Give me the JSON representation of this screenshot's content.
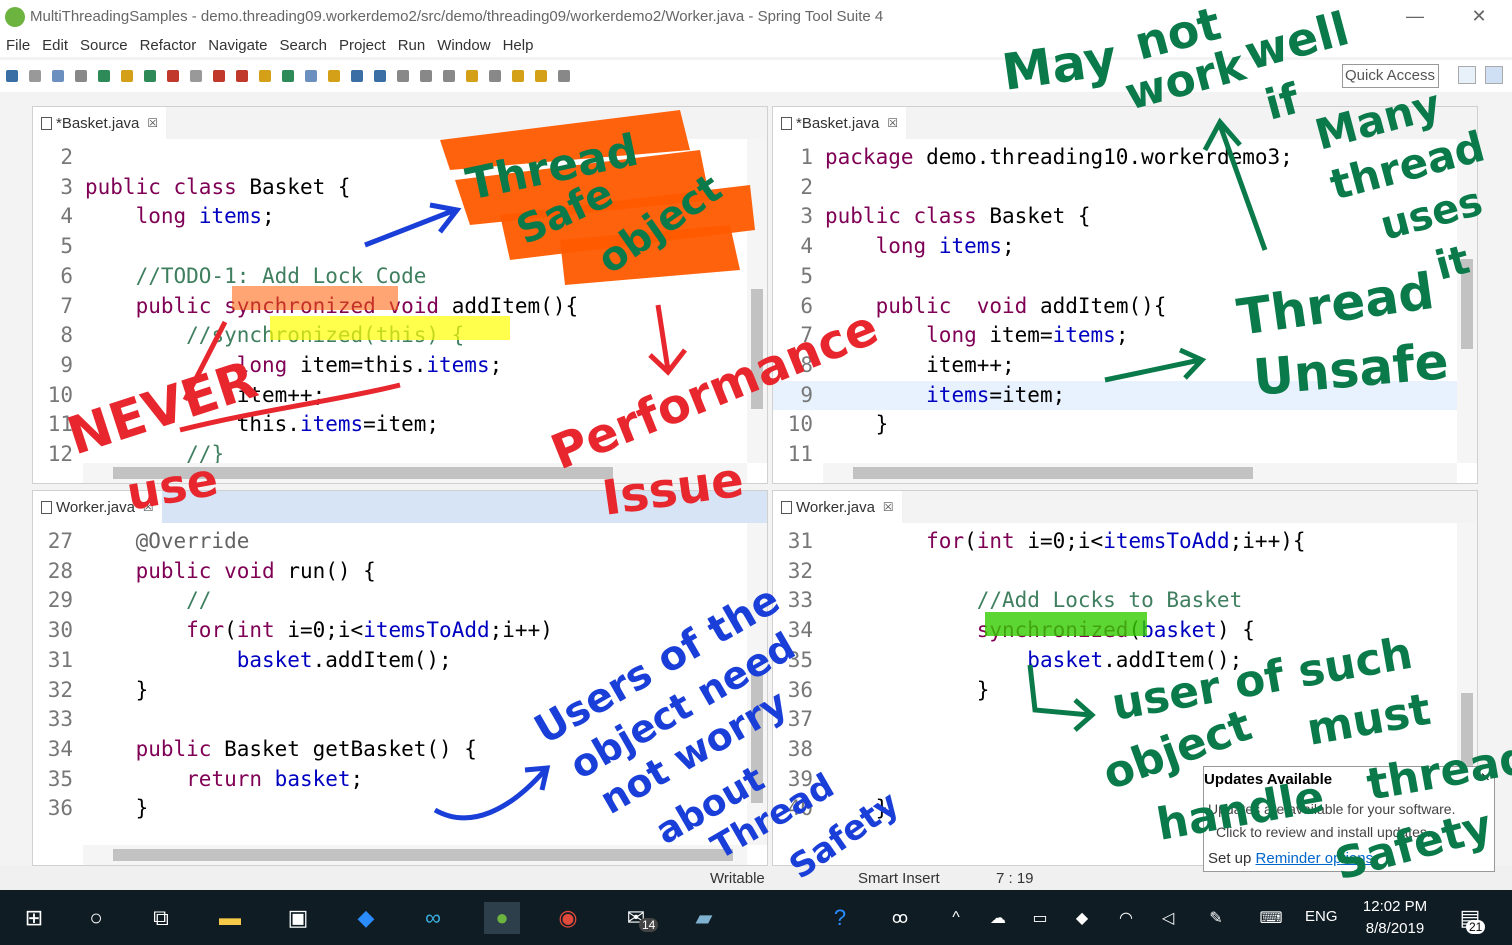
{
  "window": {
    "title": "MultiThreadingSamples - demo.threading09.workerdemo2/src/demo/threading09/workerdemo2/Worker.java - Spring Tool Suite 4",
    "minimize_glyph": "—",
    "restore_glyph": "❐",
    "close_glyph": "✕"
  },
  "menu": [
    "File",
    "Edit",
    "Source",
    "Refactor",
    "Navigate",
    "Search",
    "Project",
    "Run",
    "Window",
    "Help"
  ],
  "toolbar": {
    "quick_access": "Quick Access"
  },
  "editors": {
    "top_left": {
      "tab": "*Basket.java",
      "close": "☒",
      "lines": [
        {
          "n": "2",
          "text": ""
        },
        {
          "n": "3",
          "text": "public class Basket {"
        },
        {
          "n": "4",
          "text": "    long items;"
        },
        {
          "n": "5",
          "text": ""
        },
        {
          "n": "6",
          "text": "    //TODO-1: Add Lock Code"
        },
        {
          "n": "7",
          "text": "    public synchronized void addItem(){"
        },
        {
          "n": "8",
          "text": "        //synchronized(this) {"
        },
        {
          "n": "9",
          "text": "            long item=this.items;"
        },
        {
          "n": "10",
          "text": "            item++;"
        },
        {
          "n": "11",
          "text": "            this.items=item;"
        },
        {
          "n": "12",
          "text": "        //}"
        }
      ]
    },
    "top_right": {
      "tab": "*Basket.java",
      "close": "☒",
      "lines": [
        {
          "n": "1",
          "text": "package demo.threading10.workerdemo3;"
        },
        {
          "n": "2",
          "text": ""
        },
        {
          "n": "3",
          "text": "public class Basket {"
        },
        {
          "n": "4",
          "text": "    long items;"
        },
        {
          "n": "5",
          "text": ""
        },
        {
          "n": "6",
          "text": "    public  void addItem(){"
        },
        {
          "n": "7",
          "text": "        long item=items;"
        },
        {
          "n": "8",
          "text": "        item++;"
        },
        {
          "n": "9",
          "text": "        items=item;"
        },
        {
          "n": "10",
          "text": "    }"
        },
        {
          "n": "11",
          "text": ""
        }
      ]
    },
    "bottom_left": {
      "tab": "Worker.java",
      "close": "☒",
      "lines": [
        {
          "n": "27",
          "text": "    @Override"
        },
        {
          "n": "28",
          "text": "    public void run() {"
        },
        {
          "n": "29",
          "text": "        //"
        },
        {
          "n": "30",
          "text": "        for(int i=0;i<itemsToAdd;i++)"
        },
        {
          "n": "31",
          "text": "            basket.addItem();"
        },
        {
          "n": "32",
          "text": "    }"
        },
        {
          "n": "33",
          "text": ""
        },
        {
          "n": "34",
          "text": "    public Basket getBasket() {"
        },
        {
          "n": "35",
          "text": "        return basket;"
        },
        {
          "n": "36",
          "text": "    }"
        }
      ]
    },
    "bottom_right": {
      "tab": "Worker.java",
      "close": "☒",
      "lines": [
        {
          "n": "31",
          "text": "        for(int i=0;i<itemsToAdd;i++){"
        },
        {
          "n": "32",
          "text": ""
        },
        {
          "n": "33",
          "text": "            //Add Locks to Basket"
        },
        {
          "n": "34",
          "text": "            synchronized(basket) {"
        },
        {
          "n": "35",
          "text": "                basket.addItem();"
        },
        {
          "n": "36",
          "text": "            }"
        },
        {
          "n": "37",
          "text": ""
        },
        {
          "n": "38",
          "text": ""
        },
        {
          "n": "39",
          "text": ""
        },
        {
          "n": "40",
          "text": "    }"
        }
      ]
    }
  },
  "status": {
    "writable": "Writable",
    "insert": "Smart Insert",
    "position": "7 : 19"
  },
  "popup": {
    "title": "Updates Available",
    "body1": "Updates are available for your software.",
    "body2": "Click to review and install updates.",
    "foot_prefix": "Set up ",
    "foot_link": "Reminder options",
    "close": "×"
  },
  "taskbar": {
    "time": "12:02 PM",
    "date": "8/8/2019",
    "lang": "ENG",
    "mail_badge": "14",
    "notif_count": "21"
  },
  "annotations": {
    "thread_safe": [
      "Thread",
      "Safe",
      "object"
    ],
    "never_use": [
      "NEVER",
      "use"
    ],
    "performance": [
      "Performance",
      "Issue"
    ],
    "may_not_work": [
      "May",
      "not",
      "work",
      "well",
      "if",
      "Many",
      "thread",
      "uses",
      "it"
    ],
    "thread_unsafe": [
      "Thread",
      "Unsafe"
    ],
    "users_not_worry": [
      "Users of the",
      "object need",
      "not worry",
      "about",
      "Thread",
      "Safety"
    ],
    "user_must": [
      "user of such",
      "object",
      "must",
      "handle",
      "thread",
      "Safety"
    ]
  },
  "colors": {
    "keyword": "#7f0055",
    "field": "#0000c0",
    "comment": "#3f7f5f",
    "ink_orange": "#ff5a00",
    "ink_red": "#e8262d",
    "ink_blue": "#1a3ed8",
    "ink_green": "#0a7a4a",
    "highlight_yellow": "#ffff00",
    "highlight_green": "#33cc00"
  }
}
